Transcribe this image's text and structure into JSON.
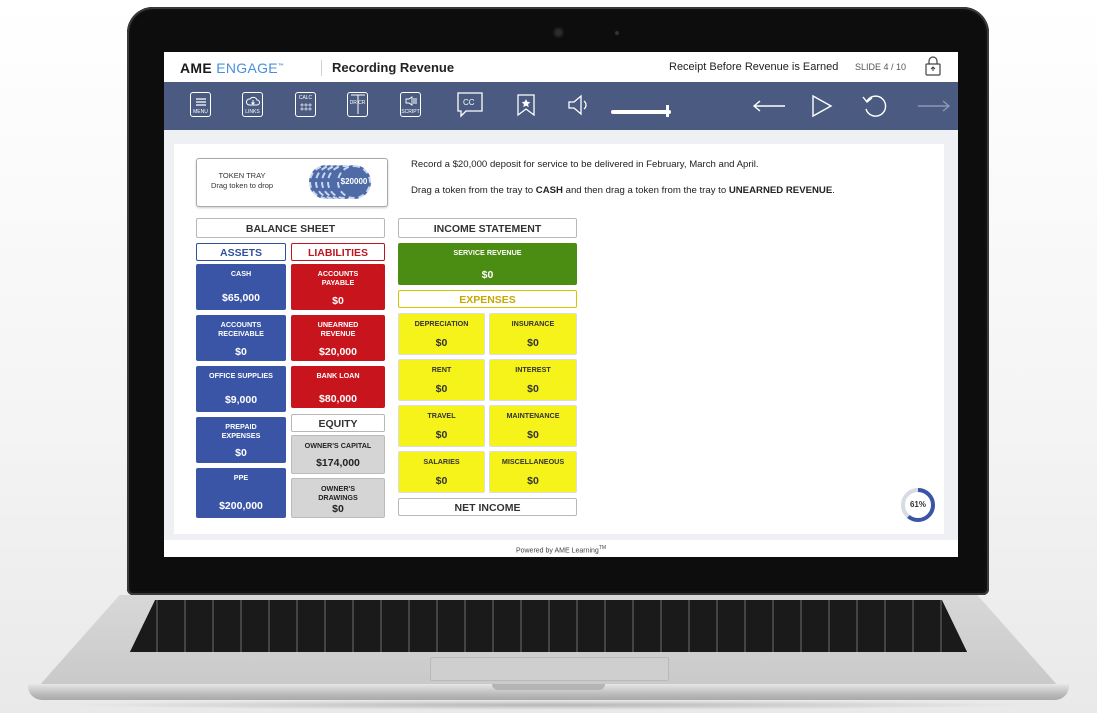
{
  "header": {
    "brand_main": "AME",
    "brand_sub": "ENGAGE",
    "brand_tm": "™",
    "lesson_title": "Recording Revenue",
    "slide_title": "Receipt Before Revenue is Earned",
    "slide_number": "SLIDE 4 / 10"
  },
  "toolbar": {
    "menu_label": "MENU",
    "links_label": "LINKS",
    "calc_label": "CALC",
    "drcr_label": "DR CR",
    "script_label": "SCRIPT",
    "cc_label": "CC",
    "volume_level": 0.92,
    "icons": [
      "menu-icon",
      "links-icon",
      "calculator-icon",
      "dr-cr-icon",
      "script-icon",
      "closed-caption-icon",
      "bookmark-icon",
      "speaker-icon",
      "back-arrow-icon",
      "play-icon",
      "replay-icon",
      "forward-arrow-icon"
    ]
  },
  "tray": {
    "title": "TOKEN TRAY",
    "subtitle": "Drag token to drop",
    "token_value": "$20000"
  },
  "instructions": {
    "line1": "Record a $20,000 deposit for service to be delivered in February, March and April.",
    "line2_pre": "Drag a token from the tray to ",
    "line2_cash": "CASH",
    "line2_mid": " and then drag a token from the tray to ",
    "line2_unearned": "UNEARNED REVENUE",
    "line2_end": "."
  },
  "balance_sheet": {
    "title": "BALANCE SHEET",
    "assets_label": "ASSETS",
    "liabilities_label": "LIABILITIES",
    "equity_label": "EQUITY",
    "assets": [
      {
        "name": "CASH",
        "value": "$65,000"
      },
      {
        "name": "ACCOUNTS RECEIVABLE",
        "value": "$0"
      },
      {
        "name": "OFFICE SUPPLIES",
        "value": "$9,000"
      },
      {
        "name": "PREPAID EXPENSES",
        "value": "$0"
      },
      {
        "name": "PPE",
        "value": "$200,000"
      }
    ],
    "liabilities": [
      {
        "name": "ACCOUNTS PAYABLE",
        "value": "$0"
      },
      {
        "name": "UNEARNED REVENUE",
        "value": "$20,000"
      },
      {
        "name": "BANK LOAN",
        "value": "$80,000"
      }
    ],
    "equity": [
      {
        "name": "OWNER'S CAPITAL",
        "value": "$174,000"
      },
      {
        "name": "OWNER'S DRAWINGS",
        "value": "$0"
      }
    ]
  },
  "income_statement": {
    "title": "INCOME STATEMENT",
    "revenue": {
      "name": "SERVICE REVENUE",
      "value": "$0"
    },
    "expenses_label": "EXPENSES",
    "expenses": [
      {
        "name": "DEPRECIATION",
        "value": "$0"
      },
      {
        "name": "INSURANCE",
        "value": "$0"
      },
      {
        "name": "RENT",
        "value": "$0"
      },
      {
        "name": "INTEREST",
        "value": "$0"
      },
      {
        "name": "TRAVEL",
        "value": "$0"
      },
      {
        "name": "MAINTENANCE",
        "value": "$0"
      },
      {
        "name": "SALARIES",
        "value": "$0"
      },
      {
        "name": "MISCELLANEOUS",
        "value": "$0"
      }
    ],
    "net_income_label": "NET INCOME"
  },
  "progress": {
    "label": "61%",
    "value": 0.61
  },
  "footer": {
    "text": "Powered by AME Learning",
    "tm": "TM"
  },
  "colors": {
    "toolbar": "#4a5a80",
    "asset_blue": "#3a55a6",
    "liability_red": "#c8141c",
    "revenue_green": "#4b8c12",
    "expense_yellow": "#f6f31a",
    "equity_grey": "#d5d5d5"
  }
}
